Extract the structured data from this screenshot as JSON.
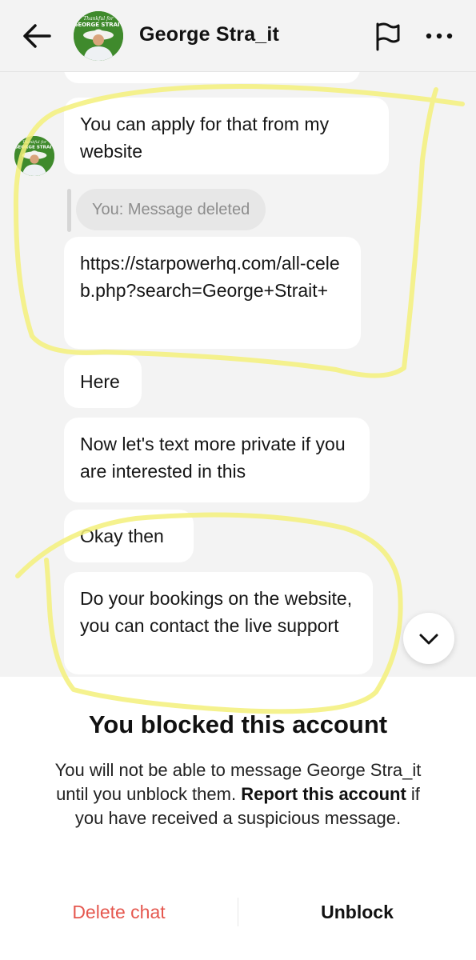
{
  "header": {
    "contact_name": "George Stra_it",
    "avatar_text": "GEORGE STRAIT",
    "avatar_script": "Thankful for",
    "back_icon": "arrow-left-icon",
    "flag_icon": "flag-icon",
    "more_icon": "more-horizontal-icon"
  },
  "messages": [
    {
      "text": "You can apply for that from my website"
    },
    {
      "text": "https://starpowerhq.com/all-celeb.php?search=George+Strait+"
    },
    {
      "text": "Here"
    },
    {
      "text": "Now let's text more private if you are interested in this"
    },
    {
      "text": "Okay then"
    },
    {
      "text": "Do your bookings on the website, you can contact the live support"
    }
  ],
  "deleted_notice": "You: Message deleted",
  "blocked": {
    "title": "You blocked this account",
    "text_part1": "You will not be able to message George Stra_it until you unblock them.",
    "text_bold": "Report this account",
    "text_part2": "if you have received a suspicious message.",
    "delete_label": "Delete chat",
    "unblock_label": "Unblock"
  },
  "colors": {
    "highlight": "#f3f07a",
    "delete": "#e5584f",
    "chat_bg": "#f3f3f3"
  }
}
